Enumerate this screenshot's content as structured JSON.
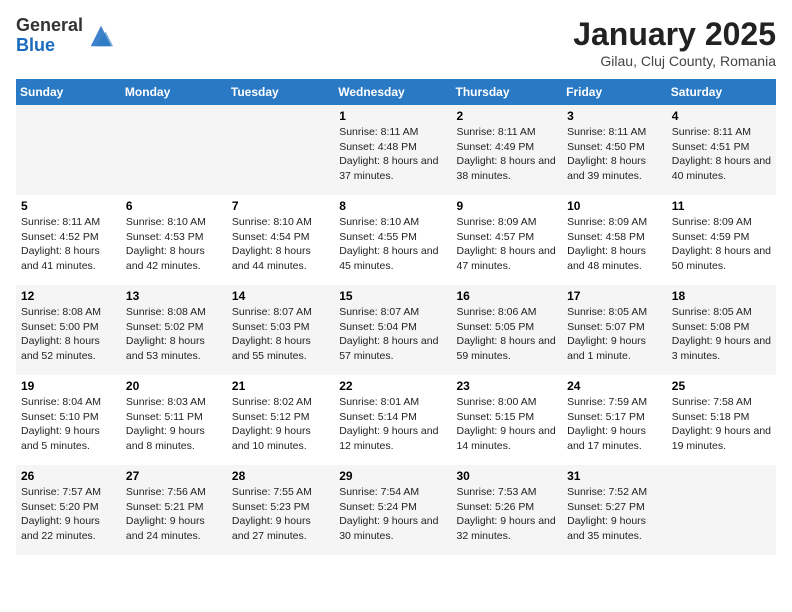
{
  "header": {
    "logo_line1": "General",
    "logo_line2": "Blue",
    "title": "January 2025",
    "subtitle": "Gilau, Cluj County, Romania"
  },
  "weekdays": [
    "Sunday",
    "Monday",
    "Tuesday",
    "Wednesday",
    "Thursday",
    "Friday",
    "Saturday"
  ],
  "weeks": [
    [
      {
        "day": "",
        "info": ""
      },
      {
        "day": "",
        "info": ""
      },
      {
        "day": "",
        "info": ""
      },
      {
        "day": "1",
        "info": "Sunrise: 8:11 AM\nSunset: 4:48 PM\nDaylight: 8 hours and 37 minutes."
      },
      {
        "day": "2",
        "info": "Sunrise: 8:11 AM\nSunset: 4:49 PM\nDaylight: 8 hours and 38 minutes."
      },
      {
        "day": "3",
        "info": "Sunrise: 8:11 AM\nSunset: 4:50 PM\nDaylight: 8 hours and 39 minutes."
      },
      {
        "day": "4",
        "info": "Sunrise: 8:11 AM\nSunset: 4:51 PM\nDaylight: 8 hours and 40 minutes."
      }
    ],
    [
      {
        "day": "5",
        "info": "Sunrise: 8:11 AM\nSunset: 4:52 PM\nDaylight: 8 hours and 41 minutes."
      },
      {
        "day": "6",
        "info": "Sunrise: 8:10 AM\nSunset: 4:53 PM\nDaylight: 8 hours and 42 minutes."
      },
      {
        "day": "7",
        "info": "Sunrise: 8:10 AM\nSunset: 4:54 PM\nDaylight: 8 hours and 44 minutes."
      },
      {
        "day": "8",
        "info": "Sunrise: 8:10 AM\nSunset: 4:55 PM\nDaylight: 8 hours and 45 minutes."
      },
      {
        "day": "9",
        "info": "Sunrise: 8:09 AM\nSunset: 4:57 PM\nDaylight: 8 hours and 47 minutes."
      },
      {
        "day": "10",
        "info": "Sunrise: 8:09 AM\nSunset: 4:58 PM\nDaylight: 8 hours and 48 minutes."
      },
      {
        "day": "11",
        "info": "Sunrise: 8:09 AM\nSunset: 4:59 PM\nDaylight: 8 hours and 50 minutes."
      }
    ],
    [
      {
        "day": "12",
        "info": "Sunrise: 8:08 AM\nSunset: 5:00 PM\nDaylight: 8 hours and 52 minutes."
      },
      {
        "day": "13",
        "info": "Sunrise: 8:08 AM\nSunset: 5:02 PM\nDaylight: 8 hours and 53 minutes."
      },
      {
        "day": "14",
        "info": "Sunrise: 8:07 AM\nSunset: 5:03 PM\nDaylight: 8 hours and 55 minutes."
      },
      {
        "day": "15",
        "info": "Sunrise: 8:07 AM\nSunset: 5:04 PM\nDaylight: 8 hours and 57 minutes."
      },
      {
        "day": "16",
        "info": "Sunrise: 8:06 AM\nSunset: 5:05 PM\nDaylight: 8 hours and 59 minutes."
      },
      {
        "day": "17",
        "info": "Sunrise: 8:05 AM\nSunset: 5:07 PM\nDaylight: 9 hours and 1 minute."
      },
      {
        "day": "18",
        "info": "Sunrise: 8:05 AM\nSunset: 5:08 PM\nDaylight: 9 hours and 3 minutes."
      }
    ],
    [
      {
        "day": "19",
        "info": "Sunrise: 8:04 AM\nSunset: 5:10 PM\nDaylight: 9 hours and 5 minutes."
      },
      {
        "day": "20",
        "info": "Sunrise: 8:03 AM\nSunset: 5:11 PM\nDaylight: 9 hours and 8 minutes."
      },
      {
        "day": "21",
        "info": "Sunrise: 8:02 AM\nSunset: 5:12 PM\nDaylight: 9 hours and 10 minutes."
      },
      {
        "day": "22",
        "info": "Sunrise: 8:01 AM\nSunset: 5:14 PM\nDaylight: 9 hours and 12 minutes."
      },
      {
        "day": "23",
        "info": "Sunrise: 8:00 AM\nSunset: 5:15 PM\nDaylight: 9 hours and 14 minutes."
      },
      {
        "day": "24",
        "info": "Sunrise: 7:59 AM\nSunset: 5:17 PM\nDaylight: 9 hours and 17 minutes."
      },
      {
        "day": "25",
        "info": "Sunrise: 7:58 AM\nSunset: 5:18 PM\nDaylight: 9 hours and 19 minutes."
      }
    ],
    [
      {
        "day": "26",
        "info": "Sunrise: 7:57 AM\nSunset: 5:20 PM\nDaylight: 9 hours and 22 minutes."
      },
      {
        "day": "27",
        "info": "Sunrise: 7:56 AM\nSunset: 5:21 PM\nDaylight: 9 hours and 24 minutes."
      },
      {
        "day": "28",
        "info": "Sunrise: 7:55 AM\nSunset: 5:23 PM\nDaylight: 9 hours and 27 minutes."
      },
      {
        "day": "29",
        "info": "Sunrise: 7:54 AM\nSunset: 5:24 PM\nDaylight: 9 hours and 30 minutes."
      },
      {
        "day": "30",
        "info": "Sunrise: 7:53 AM\nSunset: 5:26 PM\nDaylight: 9 hours and 32 minutes."
      },
      {
        "day": "31",
        "info": "Sunrise: 7:52 AM\nSunset: 5:27 PM\nDaylight: 9 hours and 35 minutes."
      },
      {
        "day": "",
        "info": ""
      }
    ]
  ]
}
